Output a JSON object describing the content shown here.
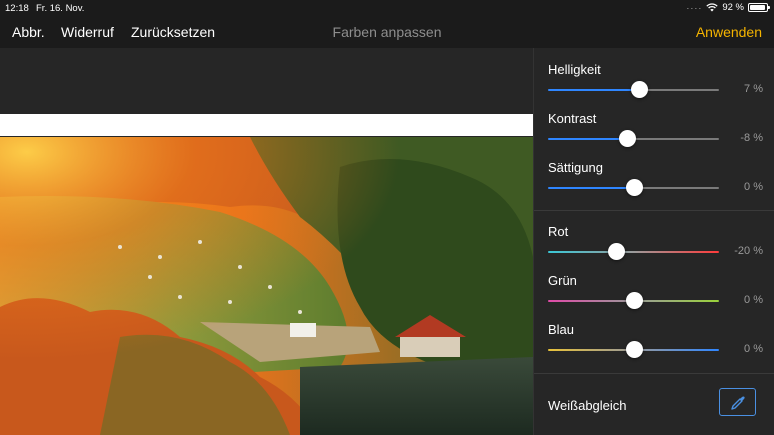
{
  "status_bar": {
    "time": "12:18",
    "date": "Fr. 16. Nov.",
    "battery": "92 %",
    "battery_level": 0.92
  },
  "toolbar": {
    "cancel_label": "Abbr.",
    "undo_label": "Widerruf",
    "reset_label": "Zurücksetzen",
    "title": "Farben anpassen",
    "apply_label": "Anwenden",
    "apply_color": "#f5b400"
  },
  "adjustments": [
    {
      "label": "Helligkeit",
      "value_text": "7 %",
      "value": 7
    },
    {
      "label": "Kontrast",
      "value_text": "-8 %",
      "value": -8
    },
    {
      "label": "Sättigung",
      "value_text": "0 %",
      "value": 0
    },
    {
      "label": "Rot",
      "value_text": "-20 %",
      "value": -20
    },
    {
      "label": "Grün",
      "value_text": "0 %",
      "value": 0
    },
    {
      "label": "Blau",
      "value_text": "0 %",
      "value": 0
    }
  ],
  "white_balance": {
    "label": "Weißabgleich",
    "icon": "eyedropper-icon"
  }
}
